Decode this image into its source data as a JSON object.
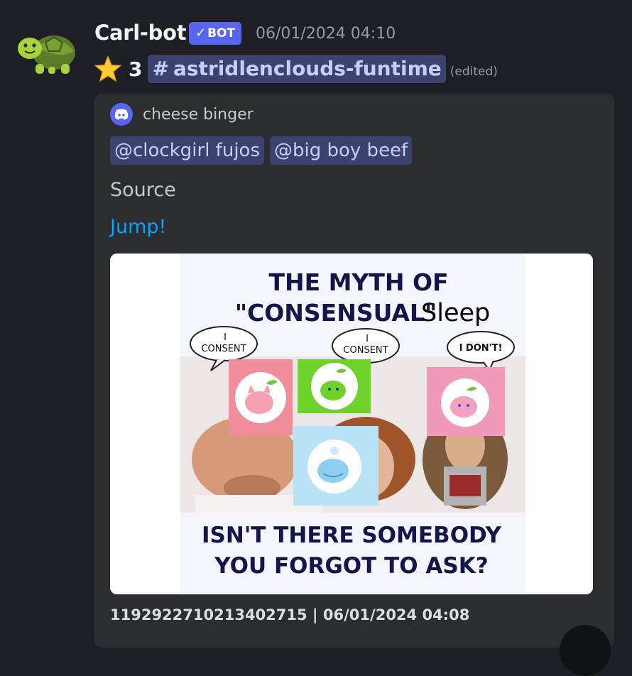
{
  "message": {
    "username": "Carl-bot",
    "bot_badge": "BOT",
    "timestamp": "06/01/2024 04:10",
    "star_count": "3",
    "channel": "astridlenclouds-funtime",
    "edited": "(edited)",
    "avatar_icon": "turtle-icon",
    "star_icon": "star-emoji-icon"
  },
  "embed": {
    "author": "cheese binger",
    "author_icon": "discord-logo-icon",
    "mentions": [
      "@clockgirl fujos",
      "@big boy beef"
    ],
    "source_label": "Source",
    "jump_label": "Jump!",
    "footer": "1192922710213402715 | 06/01/2024 04:08"
  },
  "meme": {
    "title_line1": "THE MYTH OF",
    "title_line2": "\"CONSENSUAL\"",
    "title_sleep": "Sleep",
    "bubble_left": "I CONSENT",
    "bubble_left_top": "I",
    "bubble_left_bottom": "CONSENT",
    "bubble_mid_top": "I",
    "bubble_mid_bottom": "CONSENT",
    "bubble_right": "I DON'T!",
    "caption_line1": "ISN'T THERE SOMEBODY",
    "caption_line2": "YOU FORGOT TO ASK?"
  },
  "colors": {
    "background": "#1e1f24",
    "embed_bg": "#2b2d31",
    "blurple": "#5865f2",
    "mention_bg": "#3c4270",
    "link": "#00a8fc",
    "meme_text": "#12164a"
  }
}
